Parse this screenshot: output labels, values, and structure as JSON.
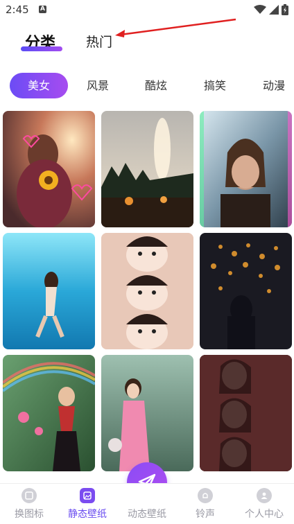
{
  "status": {
    "time": "2:45",
    "a_badge": "A"
  },
  "top_tabs": {
    "category": "分类",
    "hot": "热门"
  },
  "chips": [
    "美女",
    "风景",
    "酷炫",
    "搞笑",
    "动漫"
  ],
  "tiles": [
    {
      "name": "girl-sunflower-sunset"
    },
    {
      "name": "firework-night-landscape"
    },
    {
      "name": "woman-hands-sea"
    },
    {
      "name": "underwater-swimmer"
    },
    {
      "name": "girl-faces-triple"
    },
    {
      "name": "bokeh-lights-silhouette"
    },
    {
      "name": "girl-lotus-rainbow"
    },
    {
      "name": "girl-pink-dress-lake"
    },
    {
      "name": "girl-red-triple"
    }
  ],
  "nav": [
    {
      "label": "换图标",
      "icon": "image-icon"
    },
    {
      "label": "静态壁纸",
      "icon": "wallpaper-icon"
    },
    {
      "label": "动态壁纸",
      "icon": "send-icon"
    },
    {
      "label": "铃声",
      "icon": "bell-icon"
    },
    {
      "label": "个人中心",
      "icon": "person-icon"
    }
  ],
  "colors": {
    "accent": "#6a4cf0",
    "annotation": "#e02020"
  }
}
